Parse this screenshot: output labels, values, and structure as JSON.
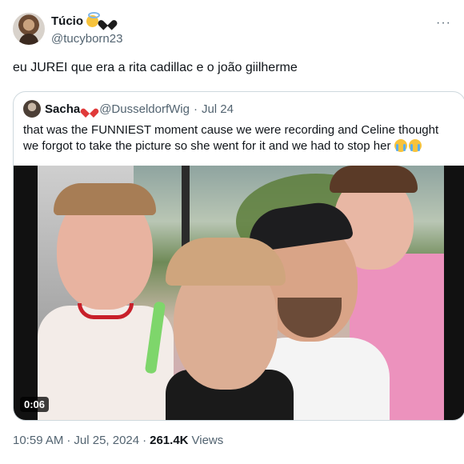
{
  "author": {
    "display_name": "Túcio",
    "handle": "@tucyborn23",
    "badges": [
      "angel-emoji",
      "black-heart-emoji"
    ]
  },
  "tweet": {
    "text": "eu JUREI que era a rita cadillac e o joão giilherme"
  },
  "quoted": {
    "display_name": "Sacha",
    "handle": "@DusseldorfWig",
    "separator": "·",
    "date": "Jul 24",
    "text": "that was the FUNNIEST moment cause we were recording and Celine thought we forgot to take the picture so she went for it and we had to stop her",
    "trailing_emoji": [
      "loudly-crying-face",
      "loudly-crying-face"
    ],
    "video": {
      "duration": "0:06"
    }
  },
  "meta": {
    "time": "10:59 AM",
    "separator1": "·",
    "date": "Jul 25, 2024",
    "separator2": "·",
    "views_count": "261.4K",
    "views_label": "Views"
  },
  "icons": {
    "more": "more-horizontal-icon"
  }
}
